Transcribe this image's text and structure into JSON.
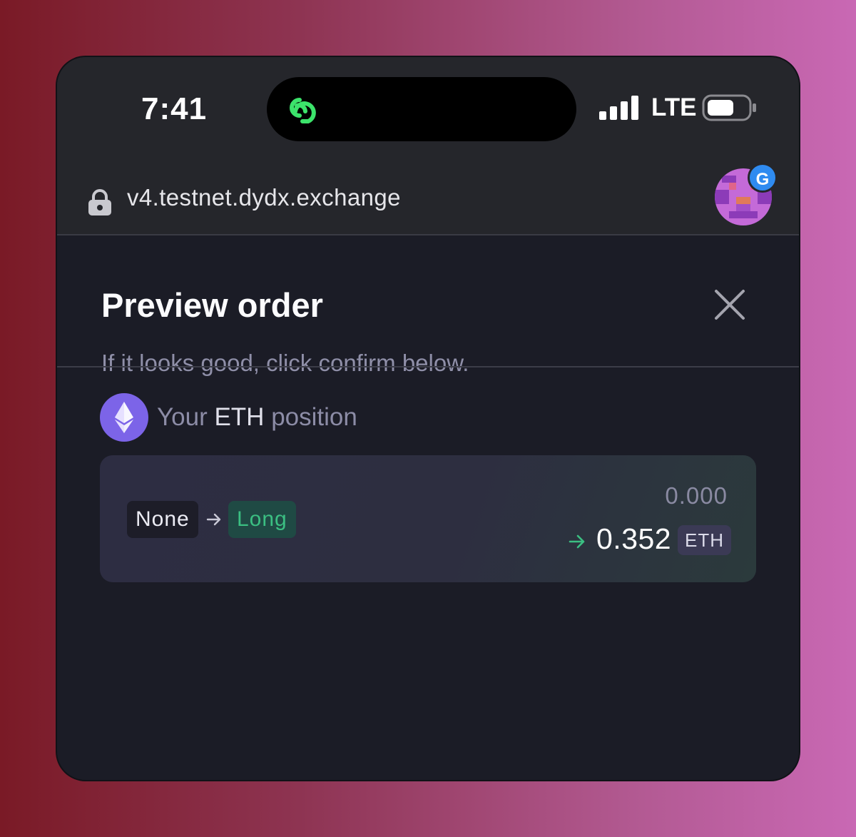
{
  "status_bar": {
    "time": "7:41",
    "network": "LTE",
    "island_icon": "link-chain-icon",
    "signal_icon": "cellular-signal-icon",
    "battery_icon": "battery-icon"
  },
  "browser": {
    "url": "v4.testnet.dydx.exchange",
    "lock_icon": "lock-icon",
    "profile_badge": "G"
  },
  "modal": {
    "title": "Preview order",
    "subtitle": "If it looks good, click confirm below.",
    "close_icon": "close-icon"
  },
  "position": {
    "label_prefix": "Your",
    "asset": "ETH",
    "label_suffix": "position",
    "side_from": "None",
    "side_to": "Long",
    "size_from": "0.000",
    "size_to": "0.352",
    "size_unit": "ETH"
  },
  "colors": {
    "accent_green": "#3bbf82",
    "eth_purple": "#7c64e8",
    "island_icon_green": "#3ce36b"
  }
}
